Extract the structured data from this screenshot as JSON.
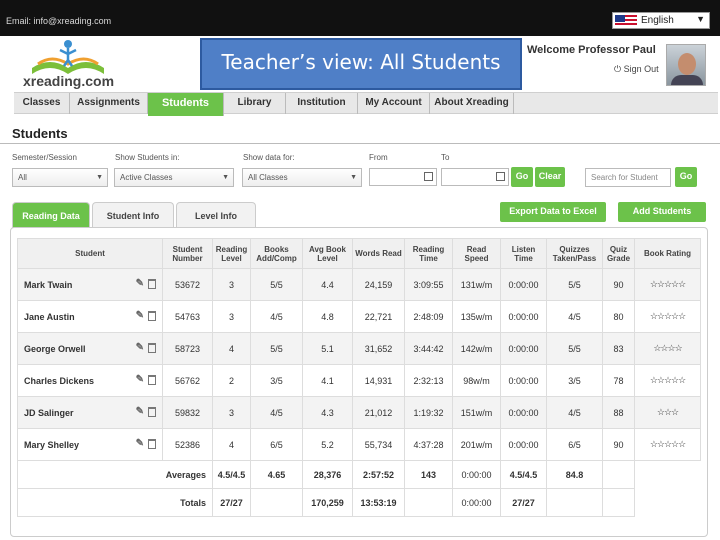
{
  "topbar": {
    "email": "Email: info@xreading.com",
    "language": "English"
  },
  "header": {
    "logo_text": "xreading.com",
    "overlay_title": "Teacher’s view: All Students",
    "welcome": "Welcome Professor Paul",
    "sign_out": "Sign Out"
  },
  "nav": {
    "items": [
      {
        "label": "Classes"
      },
      {
        "label": "Assignments"
      },
      {
        "label": "Students"
      },
      {
        "label": "Library"
      },
      {
        "label": "Institution"
      },
      {
        "label": "My Account"
      },
      {
        "label": "About Xreading"
      }
    ],
    "active": "Students"
  },
  "page": {
    "title": "Students"
  },
  "filters": {
    "semester_label": "Semester/Session",
    "semester_value": "All",
    "show_students_label": "Show Students in:",
    "show_students_value": "Active Classes",
    "show_data_label": "Show data for:",
    "show_data_value": "All Classes",
    "from_label": "From",
    "to_label": "To",
    "go": "Go",
    "clear": "Clear",
    "search_placeholder": "Search for Student",
    "search_go": "Go"
  },
  "tabs": [
    {
      "label": "Reading Data"
    },
    {
      "label": "Student Info"
    },
    {
      "label": "Level Info"
    }
  ],
  "actions": {
    "export": "Export Data to Excel",
    "add": "Add Students"
  },
  "table": {
    "headers": [
      "Student",
      "Student Number",
      "Reading Level",
      "Books Add/Comp",
      "Avg Book Level",
      "Words Read",
      "Reading Time",
      "Read Speed",
      "Listen Time",
      "Quizzes Taken/Pass",
      "Quiz Grade",
      "Book Rating"
    ],
    "rows": [
      {
        "name": "Mark Twain",
        "number": "53672",
        "level": "3",
        "books": "5/5",
        "avg_level": "4.4",
        "words": "24,159",
        "time": "3:09:55",
        "speed": "131w/m",
        "listen": "0:00:00",
        "quizzes": "5/5",
        "grade": "90",
        "stars": "☆☆☆☆☆"
      },
      {
        "name": "Jane Austin",
        "number": "54763",
        "level": "3",
        "books": "4/5",
        "avg_level": "4.8",
        "words": "22,721",
        "time": "2:48:09",
        "speed": "135w/m",
        "listen": "0:00:00",
        "quizzes": "4/5",
        "grade": "80",
        "stars": "☆☆☆☆☆"
      },
      {
        "name": "George Orwell",
        "number": "58723",
        "level": "4",
        "books": "5/5",
        "avg_level": "5.1",
        "words": "31,652",
        "time": "3:44:42",
        "speed": "142w/m",
        "listen": "0:00:00",
        "quizzes": "5/5",
        "grade": "83",
        "stars": "☆☆☆☆"
      },
      {
        "name": "Charles Dickens",
        "number": "56762",
        "level": "2",
        "books": "3/5",
        "avg_level": "4.1",
        "words": "14,931",
        "time": "2:32:13",
        "speed": "98w/m",
        "listen": "0:00:00",
        "quizzes": "3/5",
        "grade": "78",
        "stars": "☆☆☆☆☆"
      },
      {
        "name": "JD Salinger",
        "number": "59832",
        "level": "3",
        "books": "4/5",
        "avg_level": "4.3",
        "words": "21,012",
        "time": "1:19:32",
        "speed": "151w/m",
        "listen": "0:00:00",
        "quizzes": "4/5",
        "grade": "88",
        "stars": "☆☆☆"
      },
      {
        "name": "Mary Shelley",
        "number": "52386",
        "level": "4",
        "books": "6/5",
        "avg_level": "5.2",
        "words": "55,734",
        "time": "4:37:28",
        "speed": "201w/m",
        "listen": "0:00:00",
        "quizzes": "6/5",
        "grade": "90",
        "stars": "☆☆☆☆☆"
      }
    ],
    "averages": {
      "label": "Averages",
      "books": "4.5/4.5",
      "avg_level": "4.65",
      "words": "28,376",
      "time": "2:57:52",
      "speed": "143",
      "listen": "0:00:00",
      "quizzes": "4.5/4.5",
      "grade": "84.8"
    },
    "totals": {
      "label": "Totals",
      "books": "27/27",
      "words": "170,259",
      "time": "13:53:19",
      "listen": "0:00:00",
      "quizzes": "27/27"
    }
  },
  "colors": {
    "accent_green": "#6cc24a",
    "overlay_blue": "#4f7fc7"
  }
}
